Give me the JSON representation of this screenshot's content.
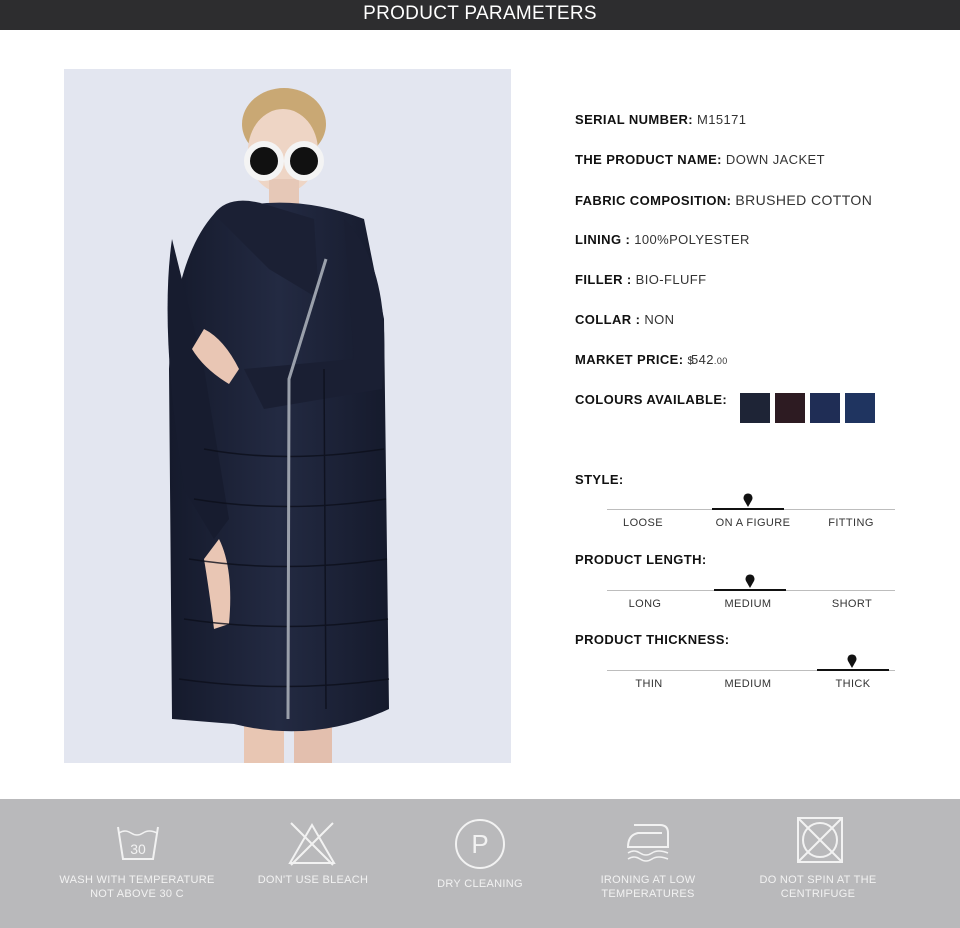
{
  "header": {
    "title": "PRODUCT PARAMETERS"
  },
  "product": {
    "serial_label": "SERIAL NUMBER:",
    "serial_value": "M15171",
    "name_label": "THE PRODUCT NAME:",
    "name_value": "DOWN JACKET",
    "fabric_label": "FABRIC COMPOSITION:",
    "fabric_value": "BRUSHED COTTON",
    "lining_label": "LINING :",
    "lining_value": "100%POLYESTER",
    "filler_label": "FILLER :",
    "filler_value": "BIO-FLUFF",
    "collar_label": "COLLAR :",
    "collar_value": "NON",
    "price_label": "MARKET PRICE:",
    "price_currency": "$",
    "price_main": "542",
    "price_cents": ".00",
    "colours_label": "COLOURS AVAILABLE:",
    "colours": [
      "#1e2436",
      "#2d1b22",
      "#1f2d55",
      "#1f3460"
    ]
  },
  "style": {
    "label": "STYLE:",
    "options": [
      "LOOSE",
      "ON A FIGURE",
      "FITTING"
    ],
    "selected": "ON A FIGURE"
  },
  "length": {
    "label": "PRODUCT LENGTH:",
    "options": [
      "LONG",
      "MEDIUM",
      "SHORT"
    ],
    "selected": "MEDIUM"
  },
  "thickness": {
    "label": "PRODUCT THICKNESS:",
    "options": [
      "THIN",
      "MEDIUM",
      "THICK"
    ],
    "selected": "THICK"
  },
  "care": [
    {
      "icon": "wash-30-icon",
      "line1": "WASH WITH TEMPERATURE",
      "line2": "NOT ABOVE 30 C",
      "symbol": "30"
    },
    {
      "icon": "no-bleach-icon",
      "line1": "DON'T USE BLEACH",
      "line2": ""
    },
    {
      "icon": "dry-clean-icon",
      "line1": "DRY CLEANING",
      "line2": "",
      "symbol": "P"
    },
    {
      "icon": "iron-low-icon",
      "line1": "IRONING AT LOW",
      "line2": "TEMPERATURES"
    },
    {
      "icon": "no-spin-icon",
      "line1": "DO NOT SPIN AT THE",
      "line2": "CENTRIFUGE"
    }
  ]
}
